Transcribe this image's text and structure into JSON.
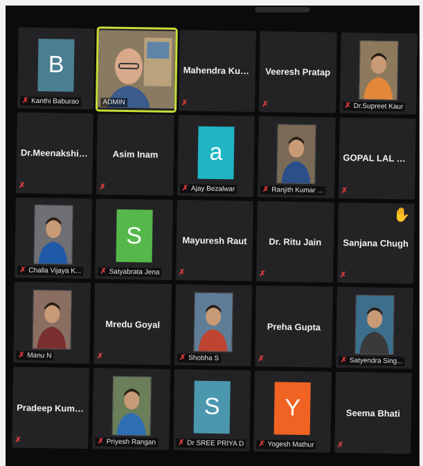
{
  "meeting": {
    "tiles": [
      {
        "name": "Kanthi Baburao",
        "type": "avatar",
        "letter": "B",
        "color": "#4a7f92",
        "muted": true
      },
      {
        "name": "ADMIN",
        "type": "photo-wide",
        "muted": false,
        "active": true
      },
      {
        "name": "Mahendra  Kum...",
        "type": "name",
        "muted": true
      },
      {
        "name": "Veeresh Pratap",
        "type": "name",
        "muted": true
      },
      {
        "name": "Dr.Supreet Kaur",
        "type": "photo",
        "muted": true
      },
      {
        "name": "Dr.Meenakshi  M...",
        "type": "name",
        "muted": true
      },
      {
        "name": "Asim Inam",
        "type": "name",
        "muted": true
      },
      {
        "name": "Ajay Bezalwar",
        "type": "avatar",
        "letter": "a",
        "color": "#1fb5c4",
        "muted": true
      },
      {
        "name": "Ranjith Kumar ...",
        "type": "photo",
        "muted": true
      },
      {
        "name": "GOPAL LAL VYAS",
        "type": "name",
        "muted": true
      },
      {
        "name": "Challa Vijaya K...",
        "type": "photo",
        "muted": true
      },
      {
        "name": "Satyabrata Jena",
        "type": "avatar",
        "letter": "S",
        "color": "#56b84a",
        "muted": true
      },
      {
        "name": "Mayuresh Raut",
        "type": "name",
        "muted": true
      },
      {
        "name": "Dr. Ritu Jain",
        "type": "name",
        "muted": true
      },
      {
        "name": "Sanjana Chugh",
        "type": "name",
        "muted": true,
        "hand_raised": true
      },
      {
        "name": "Manu N",
        "type": "photo",
        "muted": true
      },
      {
        "name": "Mredu Goyal",
        "type": "name",
        "muted": true
      },
      {
        "name": "Shobha S",
        "type": "photo",
        "muted": true
      },
      {
        "name": "Preha Gupta",
        "type": "name",
        "muted": true
      },
      {
        "name": "Satyendra Sing...",
        "type": "photo",
        "muted": true
      },
      {
        "name": "Pradeep  Kumar...",
        "type": "name",
        "muted": true
      },
      {
        "name": "Priyesh Rangan",
        "type": "photo",
        "muted": true
      },
      {
        "name": "Dr SREE PRIYA D",
        "type": "avatar",
        "letter": "S",
        "color": "#4a97ae",
        "muted": true
      },
      {
        "name": "Yogesh Mathur",
        "type": "avatar",
        "letter": "Y",
        "color": "#f06322",
        "muted": true
      },
      {
        "name": "Seema Bhati",
        "type": "name",
        "muted": true
      }
    ]
  }
}
